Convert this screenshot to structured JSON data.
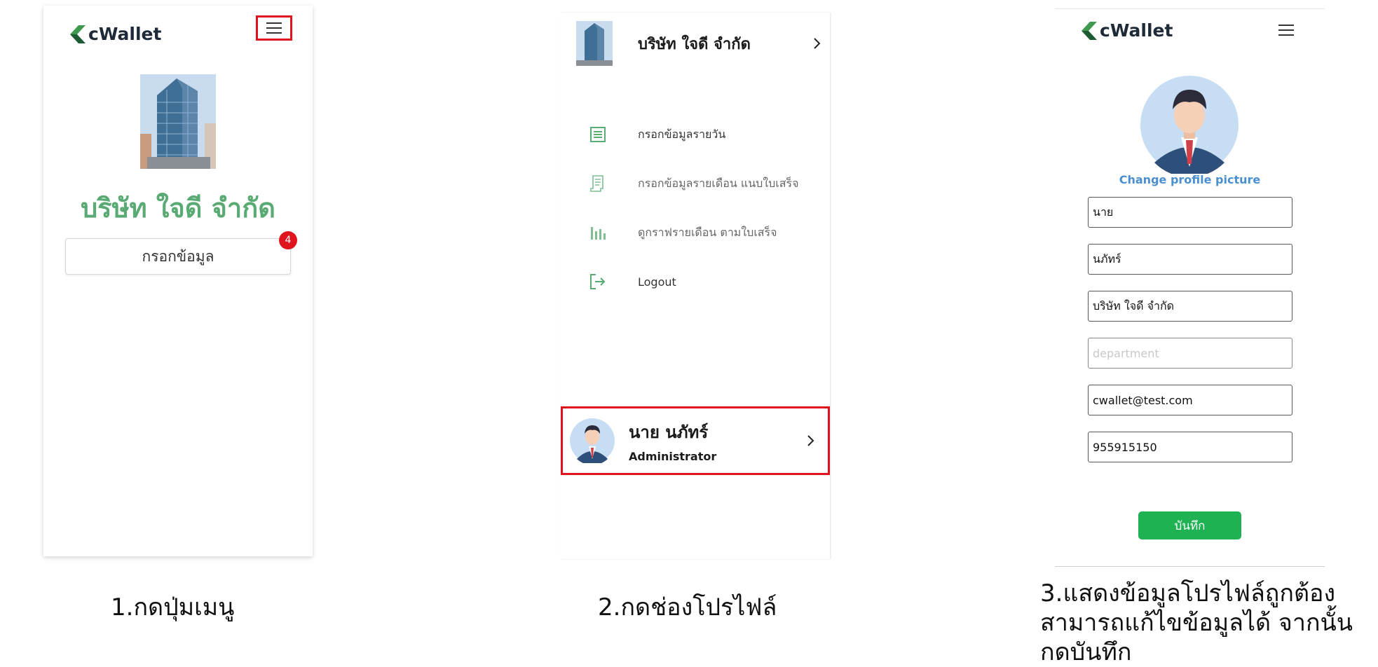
{
  "brand": {
    "name": "cWallet"
  },
  "step1": {
    "company_name": "บริษัท ใจดี จำกัด",
    "fill_button": "กรอกข้อมูล",
    "badge_count": "4"
  },
  "step2": {
    "company_name": "บริษัท ใจดี จำกัด",
    "menu": [
      {
        "label": "กรอกข้อมูลรายวัน",
        "icon": "list-icon"
      },
      {
        "label": "กรอกข้อมูลรายเดือน แนบใบเสร็จ",
        "icon": "receipt-icon"
      },
      {
        "label": "ดูกราฟรายเดือน ตามใบเสร็จ",
        "icon": "bar-chart-icon"
      },
      {
        "label": "Logout",
        "icon": "logout-icon"
      }
    ],
    "profile": {
      "name": "นาย นภัทร์",
      "role": "Administrator"
    }
  },
  "step3": {
    "change_picture": "Change profile picture",
    "fields": {
      "title": "นาย",
      "first_name": "นภัทร์",
      "company": "บริษัท ใจดี จำกัด",
      "department_placeholder": "department",
      "email": "cwallet@test.com",
      "phone": "955915150"
    },
    "save_button": "บันทึก"
  },
  "captions": {
    "c1": "1.กดปุ่มเมนู",
    "c2": "2.กดช่องโปรไฟล์",
    "c3_line1": "3.แสดงข้อมูลโปรไฟล์ถูกต้อง",
    "c3_line2": "สามารถแก้ไขข้อมูลได้ จากนั้น",
    "c3_line3": "กดบันทึก"
  },
  "colors": {
    "brand_green": "#5aaa74",
    "highlight_red": "#e0141c",
    "save_green": "#1fb253",
    "link_blue": "#4a8fd0"
  }
}
